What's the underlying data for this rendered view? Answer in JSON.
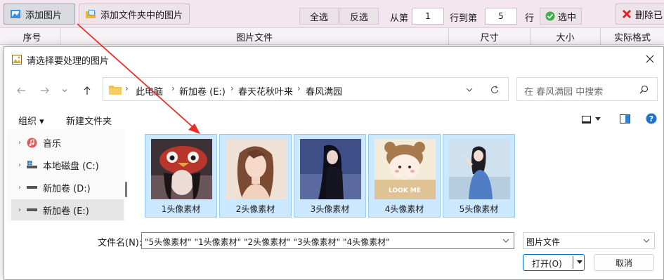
{
  "toolbar": {
    "add_image": "添加图片",
    "add_folder_images": "添加文件夹中的图片",
    "select_all": "全选",
    "invert_select": "反选",
    "from_label": "从第",
    "from_value": "1",
    "to_label": "行到第",
    "to_value": "5",
    "row_label": "行",
    "select_rows": "选中",
    "delete": "删除已"
  },
  "list_header": {
    "columns": [
      "序号",
      "图片文件",
      "尺寸",
      "大小",
      "实际格式"
    ]
  },
  "dialog": {
    "title": "请选择要处理的图片",
    "breadcrumbs": [
      "此电脑",
      "新加卷 (E:)",
      "春天花秋叶来",
      "春风满园"
    ],
    "search_placeholder": "在 春风满园 中搜索",
    "organize": "组织 ▾",
    "new_folder": "新建文件夹",
    "nav_items": [
      {
        "label": "音乐"
      },
      {
        "label": "本地磁盘 (C:)"
      },
      {
        "label": "新加卷 (D:)"
      },
      {
        "label": "新加卷 (E:)"
      }
    ],
    "files": [
      {
        "name": "1头像素材"
      },
      {
        "name": "2头像素材"
      },
      {
        "name": "3头像素材"
      },
      {
        "name": "4头像素材"
      },
      {
        "name": "5头像素材"
      }
    ],
    "filename_label": "文件名(N):",
    "filename_value": "\"5头像素材\" \"1头像素材\" \"2头像素材\" \"3头像素材\" \"4头像素材\"",
    "filetype_value": "图片文件",
    "open_label": "打开(O)",
    "cancel_label": "取消"
  },
  "colors": {
    "toolbar_bg": "#f3e6ef",
    "selection_bg": "#cce8ff",
    "selection_border": "#99c9ef",
    "accent_blue": "#0067c0",
    "arrow_red": "#e8302a"
  }
}
